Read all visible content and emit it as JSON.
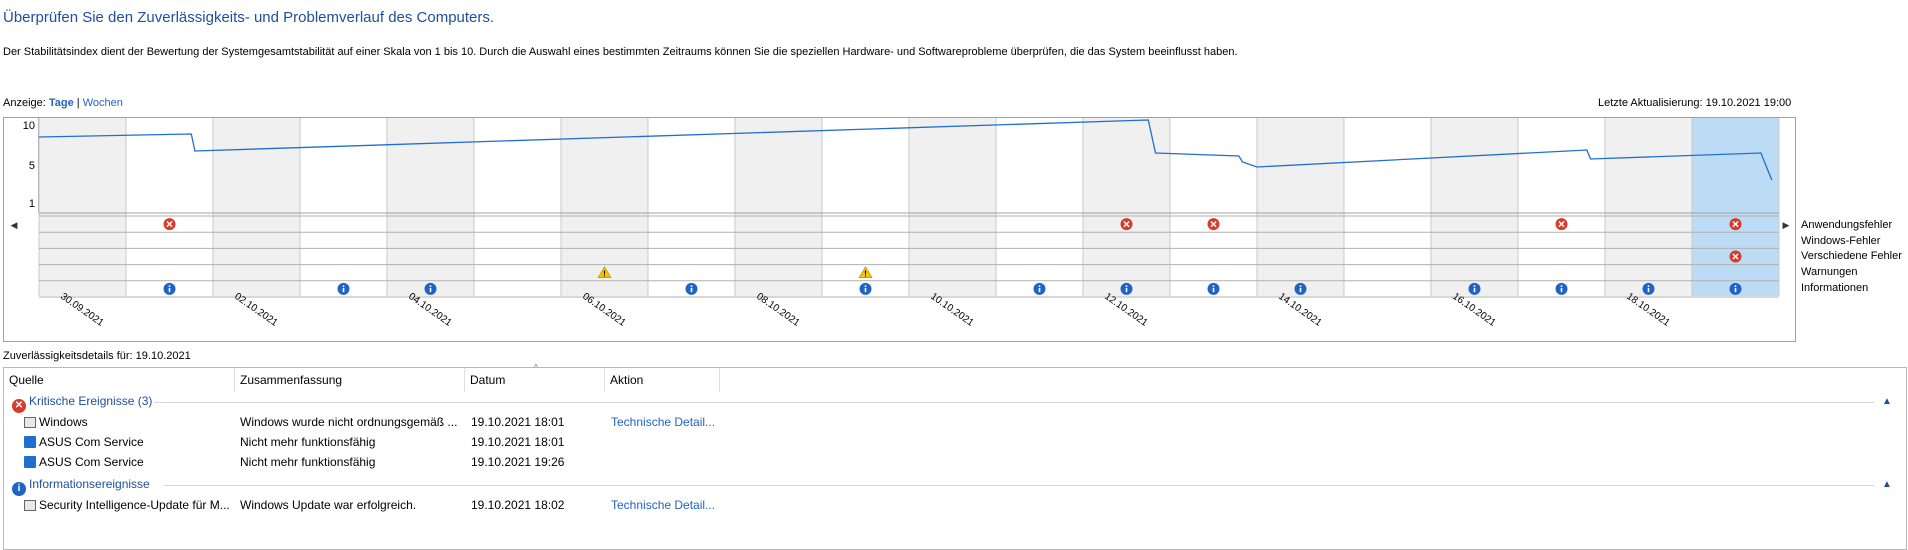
{
  "header": {
    "title": "Überprüfen Sie den Zuverlässigkeits- und Problemverlauf des Computers.",
    "description": "Der Stabilitätsindex dient der Bewertung der Systemgesamtstabilität auf einer Skala von 1 bis 10. Durch die Auswahl eines bestimmten Zeitraums können Sie die speziellen Hardware- und Softwareprobleme überprüfen, die das System beeinflusst haben.",
    "view_label": "Anzeige:",
    "view_days": "Tage",
    "view_separator": "|",
    "view_weeks": "Wochen",
    "last_update": "Letzte Aktualisierung: 19.10.2021 19:00"
  },
  "chart": {
    "y_ticks": [
      "10",
      "5",
      "1"
    ],
    "selected_day_index": 19,
    "legend": [
      "Anwendungsfehler",
      "Windows-Fehler",
      "Verschiedene Fehler",
      "Warnungen",
      "Informationen"
    ],
    "colors": {
      "line": "#1f6fd0",
      "selected": "#bcdcf5",
      "shade": "#f0f0f0",
      "error": "#d83b2b",
      "info": "#1f64c4",
      "warning": "#f5c400"
    }
  },
  "chart_data": {
    "type": "line",
    "title": "",
    "x_tick_labels": [
      "30.09.2021",
      "02.10.2021",
      "04.10.2021",
      "06.10.2021",
      "08.10.2021",
      "10.10.2021",
      "12.10.2021",
      "14.10.2021",
      "16.10.2021",
      "18.10.2021"
    ],
    "x_dates": [
      "30.09.2021",
      "01.10.2021",
      "02.10.2021",
      "03.10.2021",
      "04.10.2021",
      "05.10.2021",
      "06.10.2021",
      "07.10.2021",
      "08.10.2021",
      "09.10.2021",
      "10.10.2021",
      "11.10.2021",
      "12.10.2021",
      "13.10.2021",
      "14.10.2021",
      "15.10.2021",
      "16.10.2021",
      "17.10.2021",
      "18.10.2021",
      "19.10.2021"
    ],
    "ylim": [
      1,
      10
    ],
    "series": [
      {
        "x": [
          "30.09.2021 00:00",
          "01.10.2021 18:00",
          "01.10.2021 19:00",
          "12.10.2021 18:00",
          "12.10.2021 20:00",
          "13.10.2021 19:00",
          "13.10.2021 20:00",
          "14.10.2021 00:00",
          "17.10.2021 19:00",
          "17.10.2021 20:00",
          "19.10.2021 19:00",
          "19.10.2021 22:00"
        ],
        "values": [
          8.3,
          8.6,
          6.9,
          10.0,
          6.7,
          6.4,
          5.8,
          5.3,
          7.0,
          6.1,
          6.7,
          4.0
        ]
      }
    ],
    "events": {
      "Anwendungsfehler": [
        "01.10.2021",
        "12.10.2021",
        "13.10.2021",
        "17.10.2021",
        "19.10.2021"
      ],
      "Windows-Fehler": [],
      "Verschiedene Fehler": [
        "19.10.2021"
      ],
      "Warnungen": [
        "06.10.2021",
        "09.10.2021"
      ],
      "Informationen": [
        "01.10.2021",
        "03.10.2021",
        "04.10.2021",
        "07.10.2021",
        "09.10.2021",
        "11.10.2021",
        "12.10.2021",
        "13.10.2021",
        "14.10.2021",
        "16.10.2021",
        "17.10.2021",
        "18.10.2021",
        "19.10.2021"
      ]
    },
    "grid": true
  },
  "details": {
    "label": "Zuverlässigkeitsdetails für: 19.10.2021",
    "columns": [
      "Quelle",
      "Zusammenfassung",
      "Datum",
      "Aktion"
    ],
    "groups": [
      {
        "icon": "error-icon",
        "title": "Kritische Ereignisse (3)",
        "rows": [
          {
            "icon": "app-window-icon",
            "source": "Windows",
            "summary": "Windows wurde nicht ordnungsgemäß ...",
            "date": "19.10.2021 18:01",
            "action": "Technische Detail..."
          },
          {
            "icon": "service-icon",
            "source": "ASUS Com Service",
            "summary": "Nicht mehr funktionsfähig",
            "date": "19.10.2021 18:01",
            "action": ""
          },
          {
            "icon": "service-icon",
            "source": "ASUS Com Service",
            "summary": "Nicht mehr funktionsfähig",
            "date": "19.10.2021 19:26",
            "action": ""
          }
        ]
      },
      {
        "icon": "info-icon",
        "title": "Informationsereignisse",
        "rows": [
          {
            "icon": "app-window-icon",
            "source": "Security Intelligence-Update für M...",
            "summary": "Windows Update war erfolgreich.",
            "date": "19.10.2021 18:02",
            "action": "Technische Detail..."
          }
        ]
      }
    ]
  }
}
